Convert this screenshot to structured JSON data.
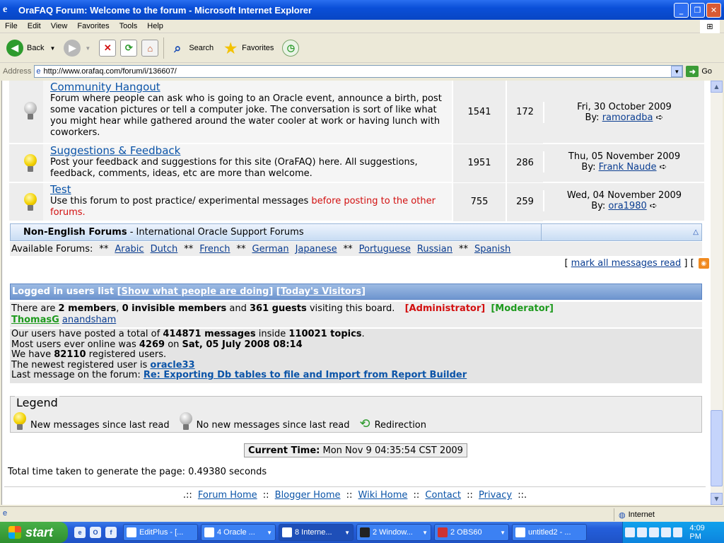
{
  "window": {
    "title": "OraFAQ Forum: Welcome to the forum - Microsoft Internet Explorer"
  },
  "menu": [
    "File",
    "Edit",
    "View",
    "Favorites",
    "Tools",
    "Help"
  ],
  "toolbar": {
    "back": "Back",
    "search": "Search",
    "favorites": "Favorites"
  },
  "address": {
    "label": "Address",
    "url": "http://www.orafaq.com/forum/i/136607/",
    "go": "Go"
  },
  "forums": [
    {
      "title": "Community Hangout",
      "desc": "Forum where people can ask who is going to an Oracle event, announce a birth, post some vacation pictures or tell a computer joke. The conversation is sort of like what you might hear while gathered around the water cooler at work or having lunch with coworkers.",
      "desc_red": "",
      "topics": "1541",
      "posts": "172",
      "date": "Fri, 30 October 2009",
      "by": "By:",
      "user": "ramoradba",
      "new": false
    },
    {
      "title": "Suggestions & Feedback",
      "desc": "Post your feedback and suggestions for this site (OraFAQ) here. All suggestions, feedback, comments, ideas, etc are more than welcome.",
      "desc_red": "",
      "topics": "1951",
      "posts": "286",
      "date": "Thu, 05 November 2009",
      "by": "By:",
      "user": "Frank Naude",
      "new": true
    },
    {
      "title": "Test",
      "desc": "Use this forum to post practice/ experimental messages ",
      "desc_red": "before posting to the other forums.",
      "topics": "755",
      "posts": "259",
      "date": "Wed, 04 November 2009",
      "by": "By:",
      "user": "ora1980",
      "new": true
    }
  ],
  "category": {
    "title": "Non-English Forums",
    "sep": " - ",
    "subtitle": "International Oracle Support Forums"
  },
  "available": {
    "label": "Available Forums:",
    "links": [
      {
        "prefix": "**",
        "name": "Arabic"
      },
      {
        "prefix": "",
        "name": "Dutch"
      },
      {
        "prefix": "**",
        "name": "French"
      },
      {
        "prefix": "**",
        "name": "German"
      },
      {
        "prefix": "",
        "name": "Japanese"
      },
      {
        "prefix": "**",
        "name": "Portuguese"
      },
      {
        "prefix": "",
        "name": "Russian"
      },
      {
        "prefix": "**",
        "name": "Spanish"
      }
    ]
  },
  "markread": {
    "open": "[ ",
    "link": "mark all messages read",
    "mid": " ] [ ",
    "close": " ]",
    "rss": "rss"
  },
  "logged": {
    "head": "Logged in users list",
    "show": "Show what people are doing",
    "today": "Today's Visitors",
    "t1": "There are ",
    "members": "2 members",
    "t2": ", ",
    "invisible": "0 invisible members",
    "t3": " and ",
    "guests": "361 guests",
    "t4": " visiting this board.",
    "admin": "[Administrator]",
    "mod": "[Moderator]",
    "u1": "ThomasG",
    "u2": "anandsham"
  },
  "stats": {
    "l1a": "Our users have posted a total of ",
    "msgs": "414871 messages",
    "l1b": " inside ",
    "topics": "110021 topics",
    "l1c": ".",
    "l2a": "Most users ever online was ",
    "most": "4269",
    "l2b": " on ",
    "mostdate": "Sat, 05 July 2008 08:14",
    "l3a": "We have ",
    "reg": "82110",
    "l3b": " registered users.",
    "l4a": "The newest registered user is ",
    "newest": "oracle33",
    "l5a": "Last message on the forum: ",
    "lastmsg": "Re: Exporting Db tables to file and Import from Report Builder"
  },
  "legend": {
    "title": "Legend",
    "new": "New messages since last read",
    "nonew": "No new messages since last read",
    "redir": "Redirection"
  },
  "time": {
    "label": "Current Time:",
    "value": "Mon Nov 9 04:35:54 CST 2009"
  },
  "gen": "Total time taken to generate the page: 0.49380 seconds",
  "footer": {
    "pre": ".:: ",
    "links": [
      "Forum Home",
      "Blogger Home",
      "Wiki Home",
      "Contact",
      "Privacy"
    ],
    "sep": " :: ",
    "post": " ::."
  },
  "status": {
    "zone": "Internet"
  },
  "taskbar": {
    "start": "start",
    "tasks": [
      "EditPlus - [...",
      "4 Oracle ...",
      "8 Interne...",
      "2 Window...",
      "2 OBS60",
      "untitled2 - ..."
    ],
    "clock": "4:09 PM"
  }
}
